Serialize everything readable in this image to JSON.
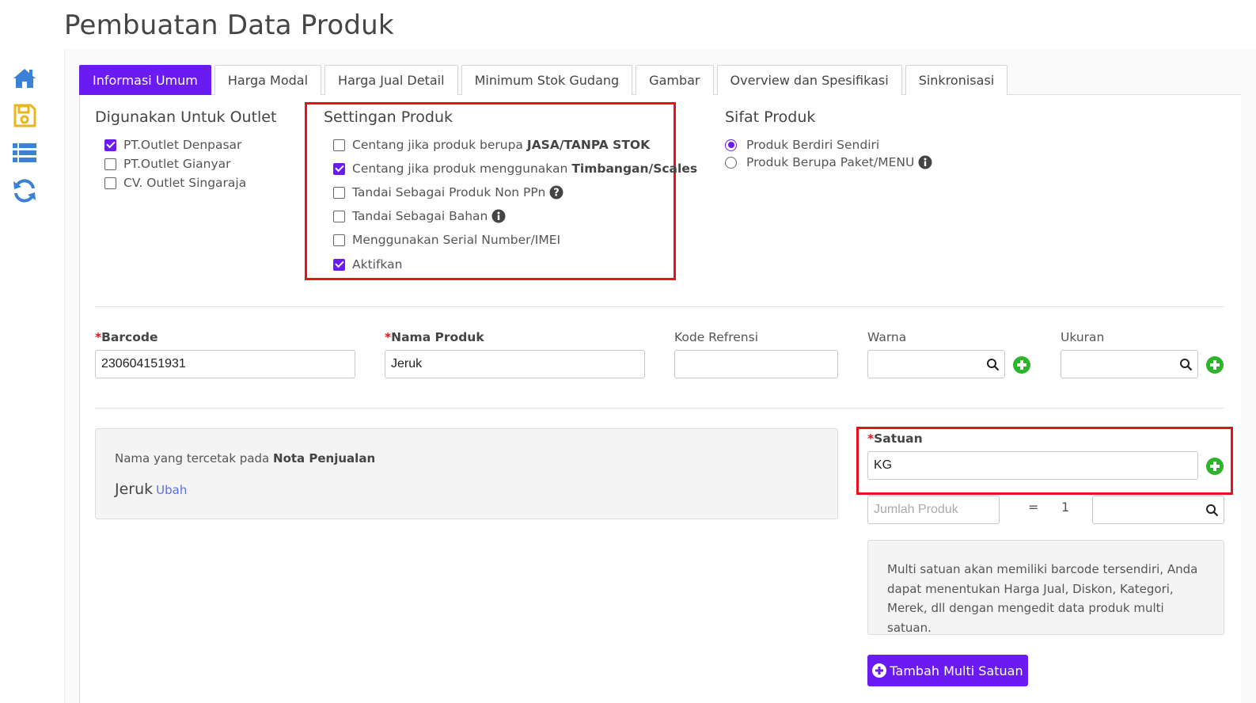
{
  "page": {
    "title": "Pembuatan Data Produk"
  },
  "sidebar": [
    {
      "icon": "home-icon"
    },
    {
      "icon": "save-icon"
    },
    {
      "icon": "list-icon"
    },
    {
      "icon": "refresh-icon"
    }
  ],
  "tabs": [
    {
      "label": "Informasi Umum",
      "active": true
    },
    {
      "label": "Harga Modal"
    },
    {
      "label": "Harga Jual Detail"
    },
    {
      "label": "Minimum Stok Gudang"
    },
    {
      "label": "Gambar"
    },
    {
      "label": "Overview dan Spesifikasi"
    },
    {
      "label": "Sinkronisasi"
    }
  ],
  "outlet": {
    "title": "Digunakan Untuk Outlet",
    "items": [
      {
        "label": "PT.Outlet Denpasar",
        "checked": true
      },
      {
        "label": "PT.Outlet Gianyar",
        "checked": false
      },
      {
        "label": "CV. Outlet Singaraja",
        "checked": false
      }
    ]
  },
  "settings": {
    "title": "Settingan Produk",
    "items": [
      {
        "text": "Centang jika produk berupa",
        "bold": "JASA/TANPA STOK",
        "checked": false
      },
      {
        "text": "Centang jika produk menggunakan",
        "bold": "Timbangan/Scales",
        "checked": true
      },
      {
        "text": "Tandai Sebagai Produk Non PPn",
        "checked": false
      },
      {
        "text": "Tandai Sebagai Bahan",
        "checked": false
      },
      {
        "text": "Menggunakan Serial Number/IMEI",
        "checked": false
      },
      {
        "text": "Aktifkan",
        "checked": true
      }
    ]
  },
  "sifat": {
    "title": "Sifat Produk",
    "options": [
      {
        "label": "Produk Berdiri Sendiri",
        "checked": true
      },
      {
        "label": "Produk Berupa Paket/MENU",
        "checked": false
      }
    ]
  },
  "fields": {
    "required_mark": "*",
    "barcode": {
      "label": "Barcode",
      "value": "230604151931"
    },
    "nama": {
      "label": "Nama Produk",
      "value": "Jeruk"
    },
    "kode": {
      "label": "Kode Refrensi",
      "value": ""
    },
    "warna": {
      "label": "Warna",
      "value": ""
    },
    "ukuran": {
      "label": "Ukuran",
      "value": ""
    }
  },
  "nota": {
    "text": "Nama yang tercetak pada",
    "bold": "Nota Penjualan",
    "name": "Jeruk",
    "ubah": "Ubah"
  },
  "satuan": {
    "label": "Satuan",
    "value": "KG",
    "jumlah_placeholder": "Jumlah Produk",
    "equals": "=",
    "one": "1",
    "info": "Multi satuan akan memiliki barcode tersendiri, Anda dapat menentukan Harga Jual, Diskon, Kategori, Merek, dll dengan mengedit data produk multi satuan.",
    "button": "Tambah Multi Satuan"
  },
  "colors": {
    "accent": "#6a1bf2",
    "highlight": "#e8121c",
    "icon_blue": "#3b82d6",
    "icon_yellow": "#e8b71a",
    "plus_green": "#2bb52b"
  }
}
